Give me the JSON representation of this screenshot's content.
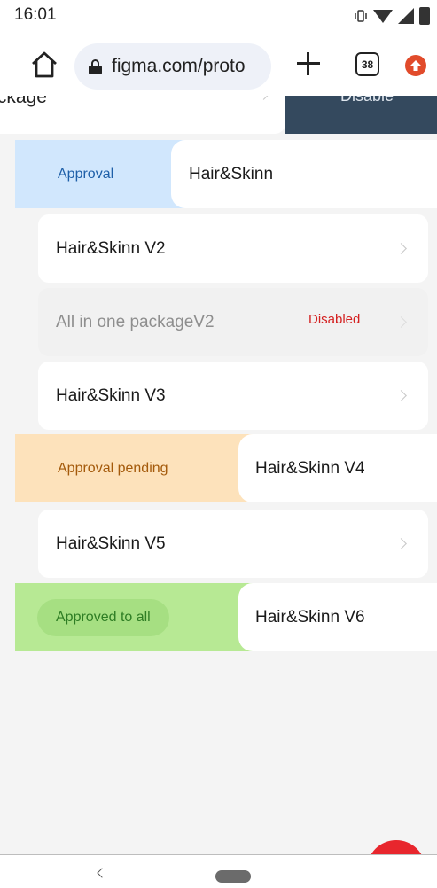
{
  "status_bar": {
    "time": "16:01",
    "icons": [
      "vibrate-icon",
      "wifi-icon",
      "signal-icon",
      "battery-icon"
    ]
  },
  "browser": {
    "url": "figma.com/proto",
    "tab_count": "38",
    "icons": [
      "home-icon",
      "lock-icon",
      "new-tab-plus-icon",
      "tab-switcher-icon",
      "update-icon"
    ]
  },
  "list": {
    "partial_row": {
      "label": "ıckage",
      "action_label": "Disable"
    },
    "approval_row": {
      "action_label": "Approval",
      "card_label": "Hair&Skinn"
    },
    "items": [
      {
        "label": "Hair&Skinn V2"
      },
      {
        "label": "All in one packageV2",
        "badge": "Disabled"
      },
      {
        "label": "Hair&Skinn V3"
      }
    ],
    "pending_row": {
      "action_label": "Approval pending",
      "card_label": "Hair&Skinn V4"
    },
    "item_v5": {
      "label": "Hair&Skinn V5"
    },
    "approved_row": {
      "action_label": "Approved to all",
      "card_label": "Hair&Skinn V6"
    }
  },
  "colors": {
    "approval_bg": "#d1e7fd",
    "approval_text": "#1e5fa8",
    "pending_bg": "#fde2bb",
    "pending_text": "#a45a0b",
    "approved_bg": "#b7e994",
    "approved_text": "#2e7d24",
    "disable_action_bg": "#34495e",
    "disabled_badge": "#d42020",
    "fab": "#e8262d"
  }
}
